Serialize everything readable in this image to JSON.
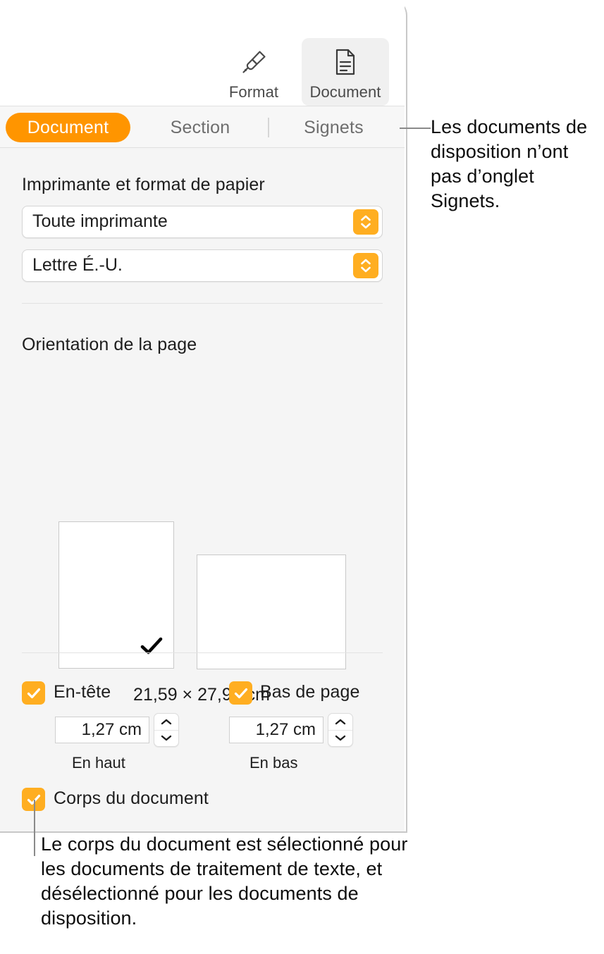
{
  "toolbar": {
    "buttons": [
      {
        "label": "Format",
        "icon": "paintbrush-icon",
        "active": false
      },
      {
        "label": "Document",
        "icon": "document-page-icon",
        "active": true
      }
    ]
  },
  "tabs": [
    {
      "label": "Document",
      "selected": true
    },
    {
      "label": "Section",
      "selected": false
    },
    {
      "label": "Signets",
      "selected": false
    }
  ],
  "printer_section": {
    "title": "Imprimante et format de papier",
    "printer": {
      "value": "Toute imprimante",
      "icon": "updown-chevrons-icon"
    },
    "paper_size": {
      "value": "Lettre É.-U.",
      "icon": "updown-chevrons-icon"
    }
  },
  "orientation_section": {
    "title": "Orientation de la page",
    "portrait": {
      "name": "portrait",
      "selected": true,
      "check": "checkmark-icon"
    },
    "landscape": {
      "name": "landscape",
      "selected": false
    },
    "dimensions": "21,59 × 27,94 cm"
  },
  "headers_section": {
    "header": {
      "label": "En-tête",
      "checked": true,
      "value": "1,27 cm",
      "sub_label": "En haut"
    },
    "footer": {
      "label": "Bas de page",
      "checked": true,
      "value": "1,27 cm",
      "sub_label": "En bas"
    },
    "body": {
      "label": "Corps du document",
      "checked": true
    }
  },
  "callouts": {
    "top": "Les documents de disposition n’ont pas d’onglet Signets.",
    "bottom": "Le corps du document est sélectionné pour les documents de traitement de texte, et désélectionné pour les documents de disposition."
  },
  "colors": {
    "accent_orange": "#FF9500",
    "control_orange": "#FFAE21",
    "panel_bg": "#F5F5F5",
    "text": "#1D1D1D",
    "muted_text": "#6E6E6E"
  }
}
